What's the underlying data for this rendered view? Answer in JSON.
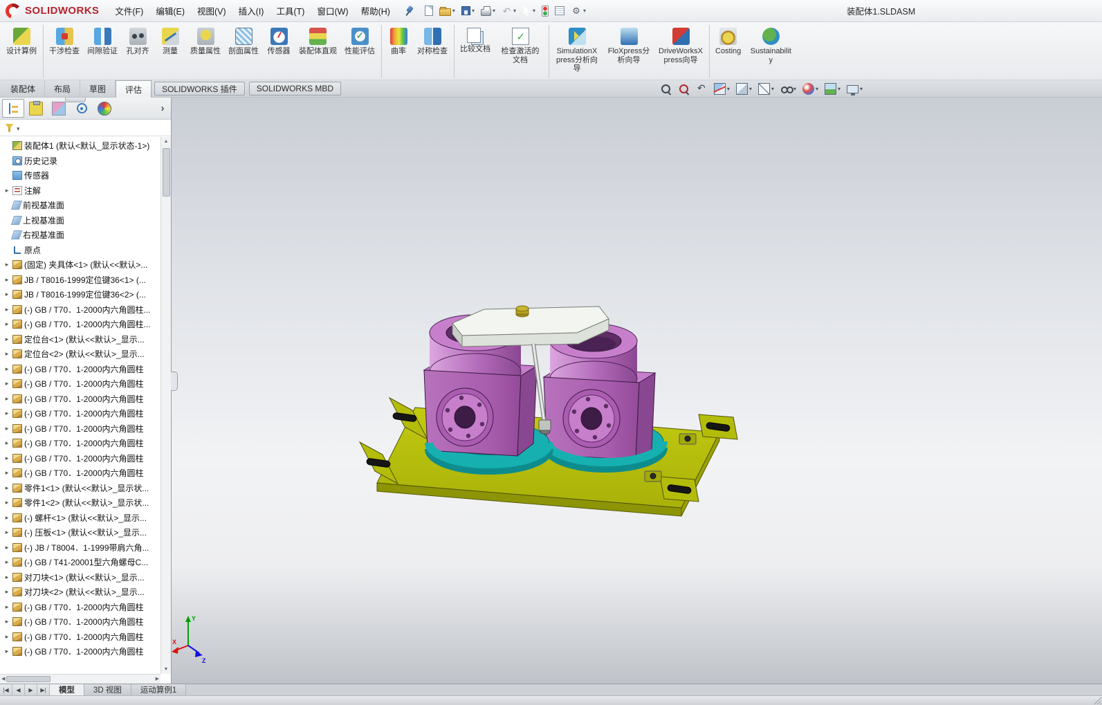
{
  "ui_colors": {
    "brand": "#b5232d",
    "accent": "#2f6fb2"
  },
  "titlebar": {
    "brand": "SOLIDWORKS",
    "document_title": "装配体1.SLDASM",
    "menus": [
      "文件(F)",
      "编辑(E)",
      "视图(V)",
      "插入(I)",
      "工具(T)",
      "窗口(W)",
      "帮助(H)"
    ],
    "quick_tools": [
      {
        "name": "new-document"
      },
      {
        "name": "open-document",
        "caret": true
      },
      {
        "name": "save",
        "caret": true
      },
      {
        "name": "print",
        "caret": true
      },
      {
        "name": "undo",
        "caret": true
      },
      {
        "name": "select-cursor",
        "caret": true
      },
      {
        "name": "selection-filter"
      },
      {
        "name": "task-scheduler"
      },
      {
        "name": "options-gear",
        "caret": true
      }
    ]
  },
  "ribbon": {
    "buttons": [
      {
        "label": "设计算例",
        "icon": "design-study"
      },
      {
        "label": "干涉检查",
        "icon": "interference",
        "sep": true
      },
      {
        "label": "间隙验证",
        "icon": "clearance"
      },
      {
        "label": "孔对齐",
        "icon": "hole-alignment"
      },
      {
        "label": "测量",
        "icon": "measure"
      },
      {
        "label": "质量属性",
        "icon": "mass-properties"
      },
      {
        "label": "剖面属性",
        "icon": "section-properties"
      },
      {
        "label": "传感器",
        "icon": "sensor"
      },
      {
        "label": "装配体直观",
        "icon": "assembly-visualization"
      },
      {
        "label": "性能评估",
        "icon": "performance"
      },
      {
        "label": "曲率",
        "icon": "curvature",
        "sep": true
      },
      {
        "label": "对称检查",
        "icon": "symmetry-check"
      },
      {
        "label": "比较文档",
        "icon": "compare-docs",
        "sep": true
      },
      {
        "label": "检查激活的文档",
        "icon": "check-active-doc"
      },
      {
        "label": "SimulationXpress分析向导",
        "icon": "simulationxpress",
        "sep": true
      },
      {
        "label": "FloXpress分析向导",
        "icon": "floxpress"
      },
      {
        "label": "DriveWorksXpress向导",
        "icon": "driveworksxpress"
      },
      {
        "label": "Costing",
        "icon": "costing",
        "sep": true
      },
      {
        "label": "Sustainability",
        "icon": "sustainability"
      }
    ]
  },
  "command_tabs": {
    "tabs": [
      {
        "label": "装配体"
      },
      {
        "label": "布局"
      },
      {
        "label": "草图"
      },
      {
        "label": "评估",
        "active": true
      },
      {
        "label": "SOLIDWORKS 插件",
        "boxed": true
      },
      {
        "label": "SOLIDWORKS MBD",
        "boxed": true
      }
    ]
  },
  "view_toolbar": {
    "buttons": [
      {
        "name": "zoom-fit"
      },
      {
        "name": "zoom-to-area"
      },
      {
        "name": "previous-view"
      },
      {
        "name": "section-view",
        "caret": true
      },
      {
        "name": "view-orientation",
        "caret": true
      },
      {
        "name": "display-style",
        "caret": true
      },
      {
        "name": "hide-show-items",
        "caret": true
      },
      {
        "name": "edit-appearance",
        "caret": true
      },
      {
        "name": "apply-scene",
        "caret": true
      },
      {
        "name": "view-settings",
        "caret": true
      }
    ]
  },
  "feature_panel": {
    "tabs": [
      {
        "name": "featuremanager-tree",
        "active": true
      },
      {
        "name": "propertymanager"
      },
      {
        "name": "configurationmanager"
      },
      {
        "name": "dimxpertmanager"
      },
      {
        "name": "displaymanager"
      }
    ],
    "tree": {
      "items": [
        {
          "label": "装配体1 (默认<默认_显示状态-1>)",
          "icon": "assembly"
        },
        {
          "label": "历史记录",
          "icon": "history"
        },
        {
          "label": "传感器",
          "icon": "sensors"
        },
        {
          "label": "注解",
          "icon": "annotations",
          "arrow": true
        },
        {
          "label": "前视基准面",
          "icon": "plane"
        },
        {
          "label": "上视基准面",
          "icon": "plane"
        },
        {
          "label": "右视基准面",
          "icon": "plane"
        },
        {
          "label": "原点",
          "icon": "origin"
        },
        {
          "label": "(固定) 夹具体<1> (默认<<默认>...",
          "icon": "part",
          "arrow": true
        },
        {
          "label": "JB / T8016-1999定位键36<1> (...",
          "icon": "part",
          "arrow": true
        },
        {
          "label": "JB / T8016-1999定位键36<2> (...",
          "icon": "part",
          "arrow": true
        },
        {
          "label": "(-) GB / T70．1-2000内六角圆柱...",
          "icon": "part",
          "arrow": true
        },
        {
          "label": "(-) GB / T70．1-2000内六角圆柱...",
          "icon": "part",
          "arrow": true
        },
        {
          "label": "定位台<1> (默认<<默认>_显示...",
          "icon": "part",
          "arrow": true
        },
        {
          "label": "定位台<2> (默认<<默认>_显示...",
          "icon": "part",
          "arrow": true
        },
        {
          "label": "(-) GB / T70．1-2000内六角圆柱",
          "icon": "part",
          "arrow": true
        },
        {
          "label": "(-) GB / T70．1-2000内六角圆柱",
          "icon": "part",
          "arrow": true
        },
        {
          "label": "(-) GB / T70．1-2000内六角圆柱",
          "icon": "part",
          "arrow": true
        },
        {
          "label": "(-) GB / T70．1-2000内六角圆柱",
          "icon": "part",
          "arrow": true
        },
        {
          "label": "(-) GB / T70．1-2000内六角圆柱",
          "icon": "part",
          "arrow": true
        },
        {
          "label": "(-) GB / T70．1-2000内六角圆柱",
          "icon": "part",
          "arrow": true
        },
        {
          "label": "(-) GB / T70．1-2000内六角圆柱",
          "icon": "part",
          "arrow": true
        },
        {
          "label": "(-) GB / T70．1-2000内六角圆柱",
          "icon": "part",
          "arrow": true
        },
        {
          "label": "零件1<1> (默认<<默认>_显示状...",
          "icon": "part",
          "arrow": true
        },
        {
          "label": "零件1<2> (默认<<默认>_显示状...",
          "icon": "part",
          "arrow": true
        },
        {
          "label": "(-) 螺杆<1> (默认<<默认>_显示...",
          "icon": "part",
          "arrow": true
        },
        {
          "label": "(-) 压板<1> (默认<<默认>_显示...",
          "icon": "part",
          "arrow": true
        },
        {
          "label": "(-) JB / T8004．1-1999带肩六角...",
          "icon": "part",
          "arrow": true
        },
        {
          "label": "(-) GB / T41-20001型六角螺母C...",
          "icon": "part",
          "arrow": true
        },
        {
          "label": "对刀块<1> (默认<<默认>_显示...",
          "icon": "part",
          "arrow": true
        },
        {
          "label": "对刀块<2> (默认<<默认>_显示...",
          "icon": "part",
          "arrow": true
        },
        {
          "label": "(-) GB / T70．1-2000内六角圆柱",
          "icon": "part",
          "arrow": true
        },
        {
          "label": "(-) GB / T70．1-2000内六角圆柱",
          "icon": "part",
          "arrow": true
        },
        {
          "label": "(-) GB / T70．1-2000内六角圆柱",
          "icon": "part",
          "arrow": true
        },
        {
          "label": "(-) GB / T70．1-2000内六角圆柱",
          "icon": "part",
          "arrow": true
        }
      ]
    }
  },
  "doc_tabs": {
    "nav": [
      "|◀",
      "◀",
      "▶",
      "▶|"
    ],
    "tabs": [
      {
        "label": "模型",
        "active": true
      },
      {
        "label": "3D 视图"
      },
      {
        "label": "运动算例1"
      }
    ]
  },
  "scene": {
    "triad": {
      "x": "X",
      "y": "Y",
      "z": "Z"
    },
    "colors": {
      "plate": "#b4bc0a",
      "plateSide": "#8d9406",
      "plateSide2": "#9aa207",
      "block": "#ab5cb0",
      "blockLight": "#c77fcc",
      "blockDark": "#8a4791",
      "blockHole": "#5e2d66",
      "ring": "#17b0b0",
      "ringDark": "#0e8c8d",
      "bar": "#f3f5f0",
      "barSide": "#dde2da",
      "barEnd": "#c9cfc7",
      "knob": "#c9b42e",
      "axisX": "#dd1111",
      "axisY": "#00a000",
      "axisZ": "#1111dd"
    }
  }
}
